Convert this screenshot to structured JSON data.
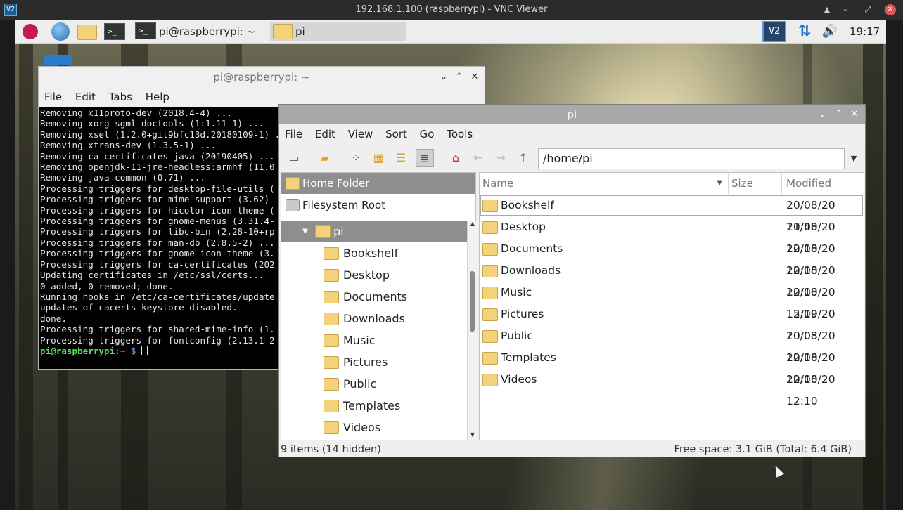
{
  "vnc_window": {
    "title": "192.168.1.100 (raspberrypi) - VNC Viewer",
    "logo_text": "V2",
    "buttons": [
      "▲",
      "–",
      "⤢",
      "✕"
    ]
  },
  "taskbar": {
    "tasks": [
      {
        "label": "pi@raspberrypi: ~"
      },
      {
        "label": "pi"
      }
    ],
    "tray": {
      "vnc": "V2",
      "network": "⇅",
      "volume": "🔊"
    },
    "clock": "19:17"
  },
  "terminal": {
    "title": "pi@raspberrypi: ~",
    "menu": [
      "File",
      "Edit",
      "Tabs",
      "Help"
    ],
    "lines": [
      "Removing x11proto-dev (2018.4-4) ...",
      "Removing xorg-sgml-doctools (1:1.11-1) ...",
      "Removing xsel (1.2.0+git9bfc13d.20180109-1) ...",
      "Removing xtrans-dev (1.3.5-1) ...",
      "Removing ca-certificates-java (20190405) ...",
      "Removing openjdk-11-jre-headless:armhf (11.0",
      "Removing java-common (0.71) ...",
      "Processing triggers for desktop-file-utils (",
      "Processing triggers for mime-support (3.62)",
      "Processing triggers for hicolor-icon-theme (",
      "Processing triggers for gnome-menus (3.31.4-",
      "Processing triggers for libc-bin (2.28-10+rp",
      "Processing triggers for man-db (2.8.5-2) ...",
      "Processing triggers for gnome-icon-theme (3.",
      "Processing triggers for ca-certificates (202",
      "Updating certificates in /etc/ssl/certs...",
      "0 added, 0 removed; done.",
      "Running hooks in /etc/ca-certificates/update",
      "",
      "updates of cacerts keystore disabled.",
      "done.",
      "Processing triggers for shared-mime-info (1.",
      "Processing triggers for fontconfig (2.13.1-2"
    ],
    "prompt_user": "pi@raspberrypi",
    "prompt_path": ":~ $"
  },
  "file_manager": {
    "title": "pi",
    "menu": [
      "File",
      "Edit",
      "View",
      "Sort",
      "Go",
      "Tools"
    ],
    "path": "/home/pi",
    "places": [
      {
        "label": "Home Folder"
      },
      {
        "label": "Filesystem Root"
      }
    ],
    "tree_root": "pi",
    "tree_items": [
      "Bookshelf",
      "Desktop",
      "Documents",
      "Downloads",
      "Music",
      "Pictures",
      "Public",
      "Templates",
      "Videos"
    ],
    "columns": [
      "Name",
      "Size",
      "Modified"
    ],
    "files": [
      {
        "name": "Bookshelf",
        "modified": "20/08/20 11:40"
      },
      {
        "name": "Desktop",
        "modified": "20/08/20 12:10"
      },
      {
        "name": "Documents",
        "modified": "20/08/20 12:10"
      },
      {
        "name": "Downloads",
        "modified": "20/08/20 12:10"
      },
      {
        "name": "Music",
        "modified": "20/08/20 12:10"
      },
      {
        "name": "Pictures",
        "modified": "15/09/20 10:03"
      },
      {
        "name": "Public",
        "modified": "20/08/20 12:10"
      },
      {
        "name": "Templates",
        "modified": "20/08/20 12:10"
      },
      {
        "name": "Videos",
        "modified": "20/08/20 12:10"
      }
    ],
    "status_left": "9 items (14 hidden)",
    "status_right": "Free space: 3.1 GiB (Total: 6.4 GiB)"
  }
}
